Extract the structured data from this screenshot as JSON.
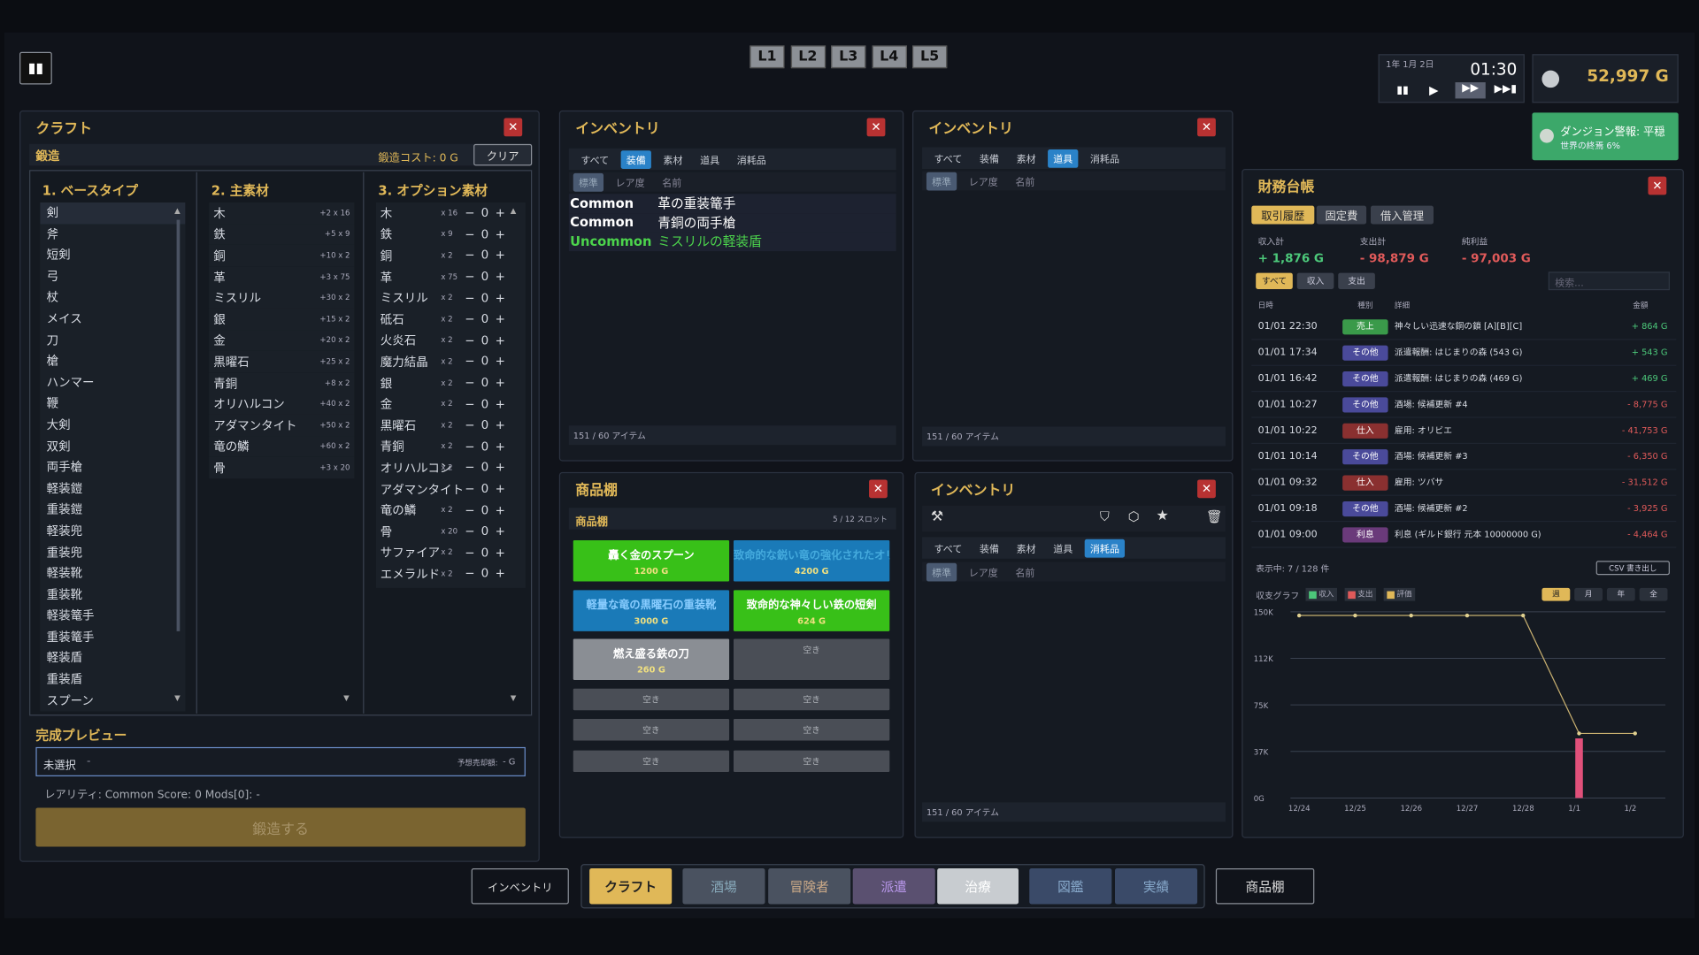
{
  "levels": [
    "L1",
    "L2",
    "L3",
    "L4",
    "L5"
  ],
  "clock": {
    "date": "1年 1月 2日",
    "time": "01:30"
  },
  "gold": "52,997 G",
  "dungeon": {
    "title": "ダンジョン警報: 平穏",
    "sub": "世界の終焉 6%"
  },
  "craft": {
    "title": "クラフト",
    "mode": "鍛造",
    "cost": "鍛造コスト: 0 G",
    "clear": "クリア",
    "col1_title": "1. ベースタイプ",
    "col2_title": "2. 主素材",
    "col3_title": "3. オプション素材",
    "base_types": [
      "剣",
      "斧",
      "短剣",
      "弓",
      "杖",
      "メイス",
      "刀",
      "槍",
      "ハンマー",
      "鞭",
      "大剣",
      "双剣",
      "両手槍",
      "軽装鎧",
      "重装鎧",
      "軽装兜",
      "重装兜",
      "軽装靴",
      "重装靴",
      "軽装篭手",
      "重装篭手",
      "軽装盾",
      "重装盾",
      "スプーン"
    ],
    "main_mats": [
      {
        "n": "木",
        "q": "+2 x 16"
      },
      {
        "n": "鉄",
        "q": "+5 x 9"
      },
      {
        "n": "銅",
        "q": "+10 x 2"
      },
      {
        "n": "革",
        "q": "+3 x 75"
      },
      {
        "n": "ミスリル",
        "q": "+30 x 2"
      },
      {
        "n": "銀",
        "q": "+15 x 2"
      },
      {
        "n": "金",
        "q": "+20 x 2"
      },
      {
        "n": "黒曜石",
        "q": "+25 x 2"
      },
      {
        "n": "青銅",
        "q": "+8 x 2"
      },
      {
        "n": "オリハルコン",
        "q": "+40 x 2"
      },
      {
        "n": "アダマンタイト",
        "q": "+50 x 2"
      },
      {
        "n": "竜の鱗",
        "q": "+60 x 2"
      },
      {
        "n": "骨",
        "q": "+3 x 20"
      }
    ],
    "opt_mats": [
      {
        "n": "木",
        "q": "x 16"
      },
      {
        "n": "鉄",
        "q": "x 9"
      },
      {
        "n": "銅",
        "q": "x 2"
      },
      {
        "n": "革",
        "q": "x 75"
      },
      {
        "n": "ミスリル",
        "q": "x 2"
      },
      {
        "n": "砥石",
        "q": "x 2"
      },
      {
        "n": "火炎石",
        "q": "x 2"
      },
      {
        "n": "魔力結晶",
        "q": "x 2"
      },
      {
        "n": "銀",
        "q": "x 2"
      },
      {
        "n": "金",
        "q": "x 2"
      },
      {
        "n": "黒曜石",
        "q": "x 2"
      },
      {
        "n": "青銅",
        "q": "x 2"
      },
      {
        "n": "オリハルコン",
        "q": "x 2"
      },
      {
        "n": "アダマンタイト",
        "q": ""
      },
      {
        "n": "竜の鱗",
        "q": "x 2"
      },
      {
        "n": "骨",
        "q": "x 20"
      },
      {
        "n": "サファイア",
        "q": "x 2"
      },
      {
        "n": "エメラルド",
        "q": "x 2"
      }
    ],
    "stepper": {
      "minus": "−",
      "zero": "0",
      "plus": "+"
    },
    "preview_title": "完成プレビュー",
    "preview_value": "未選択",
    "preview_dash": "-",
    "sell_label": "予想売却額:",
    "sell_value": "- G",
    "rarity_line": "レアリティ: Common  Score: 0  Mods[0]: -",
    "forge": "鍛造する"
  },
  "inv_tabs": [
    "すべて",
    "装備",
    "素材",
    "道具",
    "消耗品"
  ],
  "inv_sort": [
    "標準",
    "レア度",
    "名前"
  ],
  "inv_count": "151 / 60 アイテム",
  "inv1": {
    "title": "インベントリ",
    "items": [
      {
        "rarity": "Common",
        "name": "革の重装篭手"
      },
      {
        "rarity": "Common",
        "name": "青銅の両手槍"
      },
      {
        "rarity": "Uncommon",
        "name": "ミスリルの軽装盾"
      }
    ]
  },
  "inv2": {
    "title": "インベントリ"
  },
  "inv3": {
    "title": "インベントリ"
  },
  "shelf": {
    "title": "商品棚",
    "sub": "商品棚",
    "slots": "5 / 12 スロット",
    "empty": "空き",
    "items": [
      {
        "name": "轟く金のスプーン",
        "price": "1200 G"
      },
      {
        "name": "致命的な鋭い竜の強化されたオリハルコンの",
        "price": "4200 G"
      },
      {
        "name": "軽量な竜の黒曜石の重装靴",
        "price": "3000 G"
      },
      {
        "name": "致命的な神々しい鉄の短剣",
        "price": "624 G"
      },
      {
        "name": "燃え盛る鉄の刀",
        "price": "260 G"
      }
    ]
  },
  "ledger": {
    "title": "財務台帳",
    "tabs": [
      "取引履歴",
      "固定費",
      "借入管理"
    ],
    "sum": [
      {
        "label": "収入計",
        "value": "+ 1,876 G"
      },
      {
        "label": "支出計",
        "value": "- 98,879 G"
      },
      {
        "label": "純利益",
        "value": "- 97,003 G"
      }
    ],
    "filters": [
      "すべて",
      "収入",
      "支出"
    ],
    "search_placeholder": "検索...",
    "headers": [
      "日時",
      "種別",
      "詳細",
      "金額"
    ],
    "rows": [
      {
        "t": "01/01 22:30",
        "k": "売上",
        "d": "神々しい迅速な銅の鎖 [A][B][C]",
        "a": "+ 864 G"
      },
      {
        "t": "01/01 17:34",
        "k": "その他",
        "d": "派遣報酬: はじまりの森 (543 G)",
        "a": "+ 543 G"
      },
      {
        "t": "01/01 16:42",
        "k": "その他",
        "d": "派遣報酬: はじまりの森 (469 G)",
        "a": "+ 469 G"
      },
      {
        "t": "01/01 10:27",
        "k": "その他",
        "d": "酒場: 候補更新 #4",
        "a": "- 8,775 G"
      },
      {
        "t": "01/01 10:22",
        "k": "仕入",
        "d": "雇用: オリビエ",
        "a": "- 41,753 G"
      },
      {
        "t": "01/01 10:14",
        "k": "その他",
        "d": "酒場: 候補更新 #3",
        "a": "- 6,350 G"
      },
      {
        "t": "01/01 09:32",
        "k": "仕入",
        "d": "雇用: ツバサ",
        "a": "- 31,512 G"
      },
      {
        "t": "01/01 09:18",
        "k": "その他",
        "d": "酒場: 候補更新 #2",
        "a": "- 3,925 G"
      },
      {
        "t": "01/01 09:00",
        "k": "利息",
        "d": "利息 (ギルド銀行 元本 10000000 G)",
        "a": "- 4,464 G"
      }
    ],
    "showing": "表示中: 7 / 128 件",
    "csv": "CSV 書き出し",
    "graph_label": "収支グラフ",
    "legend": [
      "収入",
      "支出",
      "評価"
    ],
    "ranges": [
      "週",
      "月",
      "年",
      "全"
    ]
  },
  "chart_data": {
    "type": "line",
    "title": "収支グラフ",
    "x": [
      "12/24",
      "12/25",
      "12/26",
      "12/27",
      "12/28",
      "1/1",
      "1/2"
    ],
    "yticks": [
      "150K",
      "112K",
      "75K",
      "37K",
      "0G"
    ],
    "ylim": [
      0,
      150000
    ],
    "series": [
      {
        "name": "評価",
        "values": [
          147000,
          147000,
          147000,
          147000,
          147000,
          52000,
          52000
        ]
      },
      {
        "name": "支出",
        "values": [
          0,
          0,
          0,
          0,
          0,
          48000,
          0
        ]
      }
    ]
  },
  "nav": {
    "inventory": "インベントリ",
    "shelf": "商品棚",
    "tabs": [
      "クラフト",
      "酒場",
      "冒険者",
      "派遣",
      "治療",
      "図鑑",
      "実績"
    ]
  },
  "colors": {
    "gold": "#e0b858",
    "accent": "#2a82c8",
    "income": "#4cc87a",
    "expense": "#e05a5a",
    "uncommon": "#4cd44c",
    "forge": "#7a6430"
  }
}
